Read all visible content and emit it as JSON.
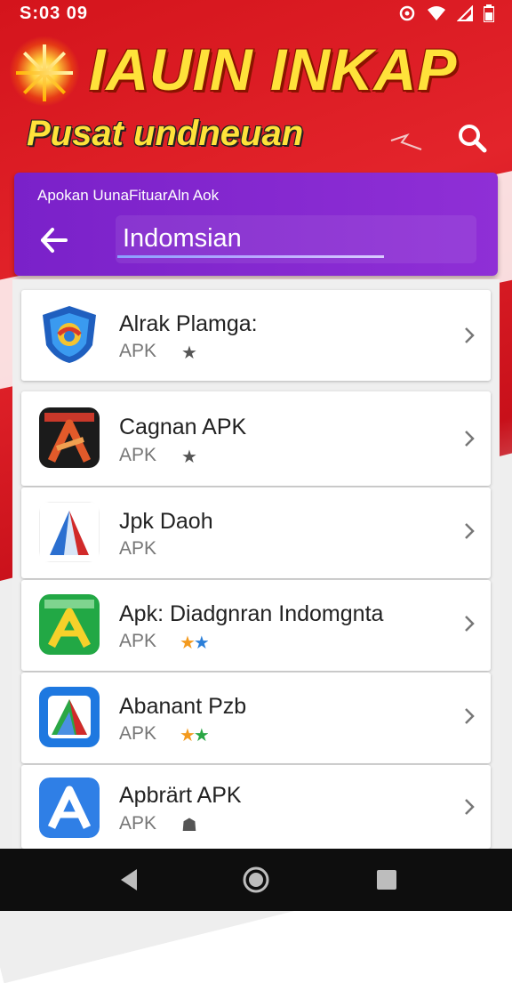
{
  "status_bar": {
    "time": "S:03  09",
    "icons": [
      "sync-icon",
      "wifi-icon",
      "signal-icon",
      "battery-icon"
    ]
  },
  "header": {
    "title": "IAUIN INKAP",
    "subtitle": "Pusat undneuan",
    "search_icon": "search-icon"
  },
  "search_card": {
    "caption": "Apokan UunaFituarAln Aok",
    "value": "Indomsian",
    "back_icon": "arrow-left-icon"
  },
  "results": [
    {
      "title": "Alrak Plamga:",
      "subtitle": "APK",
      "stars": "★",
      "star_colors": [
        "#555555"
      ],
      "icon": "shield-app-icon"
    },
    {
      "title": "Cagnan APK",
      "subtitle": "APK",
      "stars": "★",
      "star_colors": [
        "#555555"
      ],
      "icon": "pen-app-icon"
    },
    {
      "title": "Jpk Daoh",
      "subtitle": "APK",
      "stars": "",
      "star_colors": [],
      "icon": "triangle-app-icon"
    },
    {
      "title": "Apk: Diadgnran Indomgnta",
      "subtitle": "APK",
      "stars": "★★",
      "star_colors": [
        "#f39a1e",
        "#2b7fd9"
      ],
      "icon": "green-a-app-icon"
    },
    {
      "title": "Abanant Pzb",
      "subtitle": "APK",
      "stars": "★★",
      "star_colors": [
        "#f39a1e",
        "#2aa745"
      ],
      "icon": "blue-map-app-icon"
    },
    {
      "title": "Apbrärt APK",
      "subtitle": "APK",
      "stars": "☗",
      "star_colors": [
        "#555555"
      ],
      "icon": "blue-a-app-icon"
    }
  ],
  "navbar": {
    "icons": [
      "back-triangle-icon",
      "home-circle-icon",
      "recents-square-icon"
    ]
  },
  "colors": {
    "banner_red": "#d4141c",
    "title_yellow": "#ffe23a",
    "card_purple": "#7a21c9",
    "nav_black": "#0e0e0e"
  }
}
